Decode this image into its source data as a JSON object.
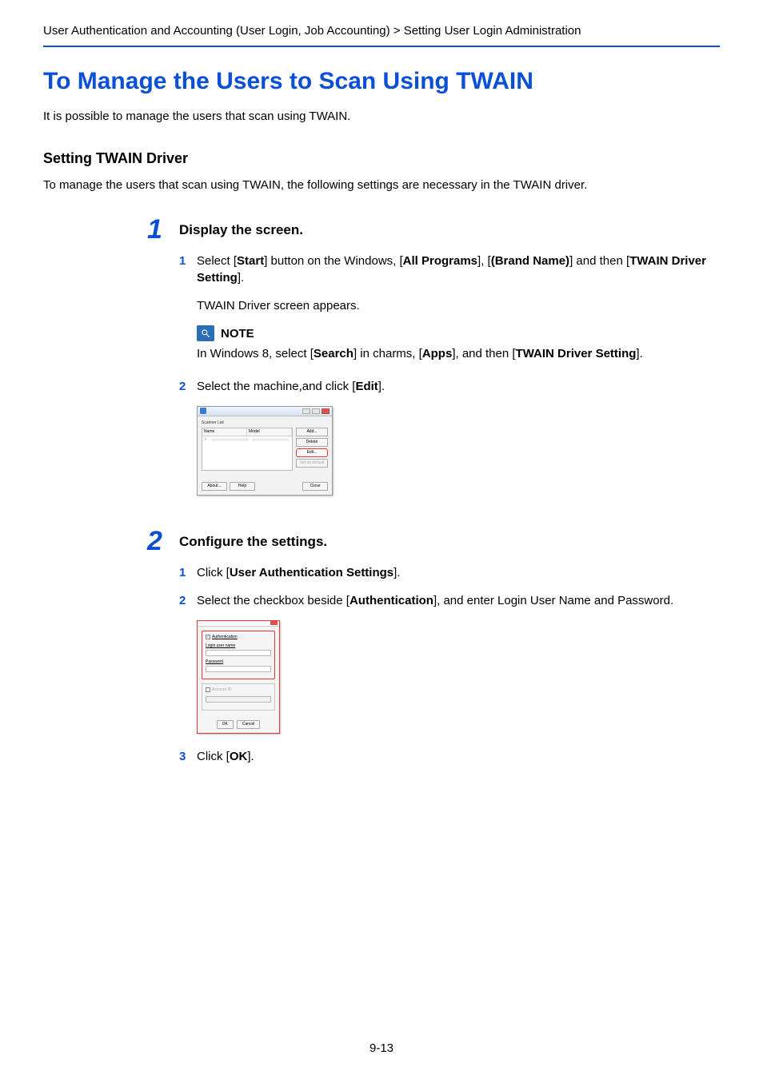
{
  "breadcrumb": "User Authentication and Accounting (User Login, Job Accounting) > Setting User Login Administration",
  "page_title": "To Manage the Users to Scan Using TWAIN",
  "intro": "It is possible to manage the users that scan using TWAIN.",
  "section_heading": "Setting TWAIN Driver",
  "section_text": "To manage the users that scan using TWAIN, the following settings are necessary in the TWAIN driver.",
  "step1": {
    "num": "1",
    "title": "Display the screen.",
    "sub1": {
      "num": "1",
      "pre": "Select [",
      "b1": "Start",
      "mid1": "] button on the Windows, [",
      "b2": "All Programs",
      "mid2": "], [",
      "b3": "(Brand Name)",
      "mid3": "] and then [",
      "b4": "TWAIN Driver Setting",
      "post": "]."
    },
    "sub1_note": "TWAIN Driver screen appears.",
    "note_label": "NOTE",
    "note_body_pre": "In Windows 8, select [",
    "note_b1": "Search",
    "note_mid1": "] in charms, [",
    "note_b2": "Apps",
    "note_mid2": "], and then [",
    "note_b3": "TWAIN Driver Setting",
    "note_post": "].",
    "sub2": {
      "num": "2",
      "pre": "Select the machine,and click [",
      "b1": "Edit",
      "post": "]."
    }
  },
  "dlg1": {
    "group": "Scanner List",
    "col_name": "Name",
    "col_model": "Model",
    "btn_add": "Add...",
    "btn_delete": "Delete",
    "btn_edit": "Edit...",
    "btn_setdefault": "Set as default",
    "btn_about": "About...",
    "btn_help": "Help",
    "btn_close": "Close"
  },
  "step2": {
    "num": "2",
    "title": "Configure the settings.",
    "sub1": {
      "num": "1",
      "pre": "Click [",
      "b1": "User Authentication Settings",
      "post": "]."
    },
    "sub2": {
      "num": "2",
      "pre": "Select the checkbox beside [",
      "b1": "Authentication",
      "post": "], and enter Login User Name and Password."
    },
    "sub3": {
      "num": "3",
      "pre": "Click [",
      "b1": "OK",
      "post": "]."
    }
  },
  "dlg2": {
    "chk_auth": "Authentication",
    "login_label": "Login user name",
    "password_label": "Password",
    "account_label": "Account ID",
    "btn_ok": "OK",
    "btn_cancel": "Cancel"
  },
  "page_number": "9-13"
}
